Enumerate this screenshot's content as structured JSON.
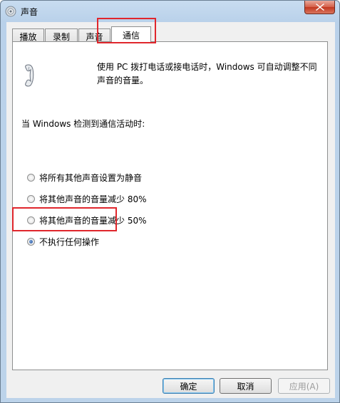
{
  "window": {
    "title": "声音"
  },
  "tabs": [
    {
      "label": "播放"
    },
    {
      "label": "录制"
    },
    {
      "label": "声音"
    },
    {
      "label": "通信"
    }
  ],
  "comm": {
    "description": "使用 PC 拨打电话或接电话时，Windows 可自动调整不同声音的音量。",
    "section_label": "当 Windows 检测到通信活动时:",
    "options": [
      {
        "label": "将所有其他声音设置为静音",
        "checked": false
      },
      {
        "label": "将其他声音的音量减少 80%",
        "checked": false
      },
      {
        "label": "将其他声音的音量减少 50%",
        "checked": false
      },
      {
        "label": "不执行任何操作",
        "checked": true
      }
    ]
  },
  "buttons": {
    "ok": "确定",
    "cancel": "取消",
    "apply": "应用(A)"
  },
  "colors": {
    "highlight": "#e0262c"
  }
}
